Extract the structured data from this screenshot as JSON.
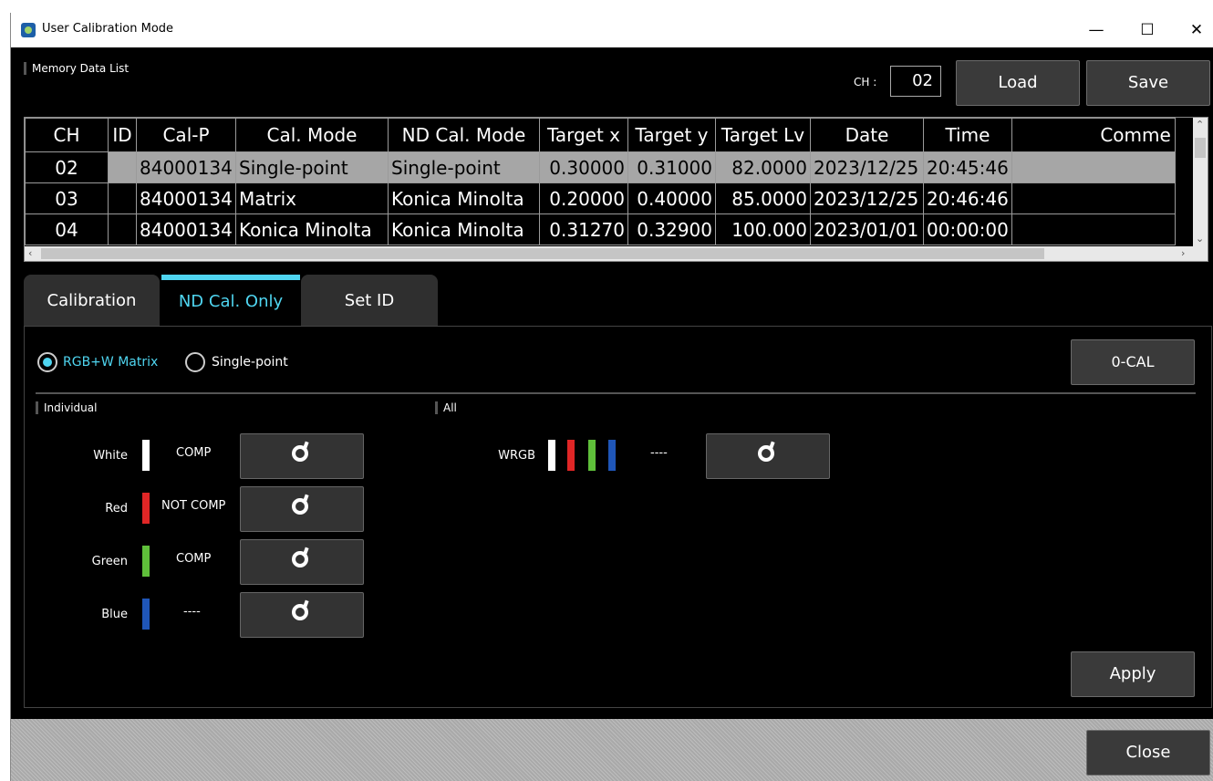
{
  "window": {
    "title": "User Calibration Mode",
    "min": "—",
    "max": "☐",
    "close": "✕"
  },
  "memory": {
    "label": "Memory Data List",
    "ch_label": "CH :",
    "ch_value": "02",
    "load_label": "Load",
    "save_label": "Save"
  },
  "table": {
    "headers": [
      "CH",
      "ID",
      "Cal-P",
      "Cal. Mode",
      "ND Cal. Mode",
      "Target x",
      "Target y",
      "Target Lv",
      "Date",
      "Time",
      "Comme"
    ],
    "rows": [
      [
        "02",
        "",
        "84000134",
        "Single-point",
        "Single-point",
        "0.30000",
        "0.31000",
        "82.0000",
        "2023/12/25",
        "20:45:46",
        ""
      ],
      [
        "03",
        "",
        "84000134",
        "Matrix",
        "Konica Minolta",
        "0.20000",
        "0.40000",
        "85.0000",
        "2023/12/25",
        "20:46:46",
        ""
      ],
      [
        "04",
        "",
        "84000134",
        "Konica Minolta",
        "Konica Minolta",
        "0.31270",
        "0.32900",
        "100.000",
        "2023/01/01",
        "00:00:00",
        ""
      ]
    ]
  },
  "tabs": [
    {
      "label": "Calibration"
    },
    {
      "label": "ND Cal. Only"
    },
    {
      "label": "Set ID"
    }
  ],
  "nd": {
    "radio_matrix": "RGB+W Matrix",
    "radio_single": "Single-point",
    "zero_cal": "0-CAL",
    "individual_label": "Individual",
    "all_label": "All",
    "rows": [
      {
        "label": "White",
        "status": "COMP",
        "color": "#ffffff"
      },
      {
        "label": "Red",
        "status": "NOT COMP",
        "color": "#e02626"
      },
      {
        "label": "Green",
        "status": "COMP",
        "color": "#5fbf3a"
      },
      {
        "label": "Blue",
        "status": "----",
        "color": "#1f56b8"
      }
    ],
    "all_row": {
      "label": "WRGB",
      "status": "----",
      "colors": [
        "#ffffff",
        "#e02626",
        "#5fbf3a",
        "#1f56b8"
      ]
    },
    "measure_icon": "measure-icon",
    "apply_label": "Apply"
  },
  "footer": {
    "close_label": "Close"
  }
}
